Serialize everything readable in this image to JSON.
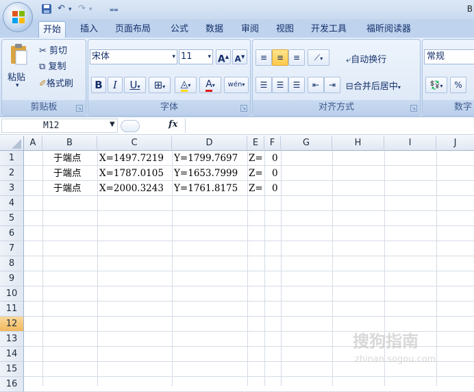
{
  "window": {
    "title": "B"
  },
  "tabs": [
    "开始",
    "插入",
    "页面布局",
    "公式",
    "数据",
    "审阅",
    "视图",
    "开发工具",
    "福昕阅读器"
  ],
  "clipboard": {
    "paste_label": "粘贴",
    "cut_label": "剪切",
    "copy_label": "复制",
    "format_painter_label": "格式刷",
    "group_label": "剪贴板"
  },
  "font": {
    "name": "宋体",
    "size": "11",
    "bold": "B",
    "italic": "I",
    "underline": "U",
    "font_color_glyph": "A",
    "grow_glyph": "A",
    "shrink_glyph": "A",
    "phonetic_glyph": "wén",
    "group_label": "字体"
  },
  "alignment": {
    "wrap_label": "自动换行",
    "merge_label": "合并后居中",
    "group_label": "对齐方式"
  },
  "number": {
    "format": "常规",
    "percent": "%",
    "group_label": "数字"
  },
  "formula_bar": {
    "name_box": "M12",
    "fx": "fx",
    "formula": ""
  },
  "columns": [
    "A",
    "B",
    "C",
    "D",
    "E",
    "F",
    "G",
    "H",
    "I",
    "J"
  ],
  "rows": [
    "1",
    "2",
    "3",
    "4",
    "5",
    "6",
    "7",
    "8",
    "9",
    "10",
    "11",
    "12",
    "13",
    "14",
    "15",
    "16"
  ],
  "selected_row": "12",
  "cells": [
    {
      "b": "于端点",
      "c": "X=1497.7219",
      "d": "Y=1799.7697",
      "e": "Z=",
      "f": "0"
    },
    {
      "b": "于端点",
      "c": "X=1787.0105",
      "d": "Y=1653.7999",
      "e": "Z=",
      "f": "0"
    },
    {
      "b": "于端点",
      "c": "X=2000.3243",
      "d": "Y=1761.8175",
      "e": "Z=",
      "f": "0"
    }
  ],
  "watermark": {
    "line1": "搜狗指南",
    "line2": "zhinan.sogou.com"
  },
  "colors": {
    "accent": "#15306b",
    "ribbon": "#d4e2f4",
    "selected_row": "#f1b95c"
  }
}
